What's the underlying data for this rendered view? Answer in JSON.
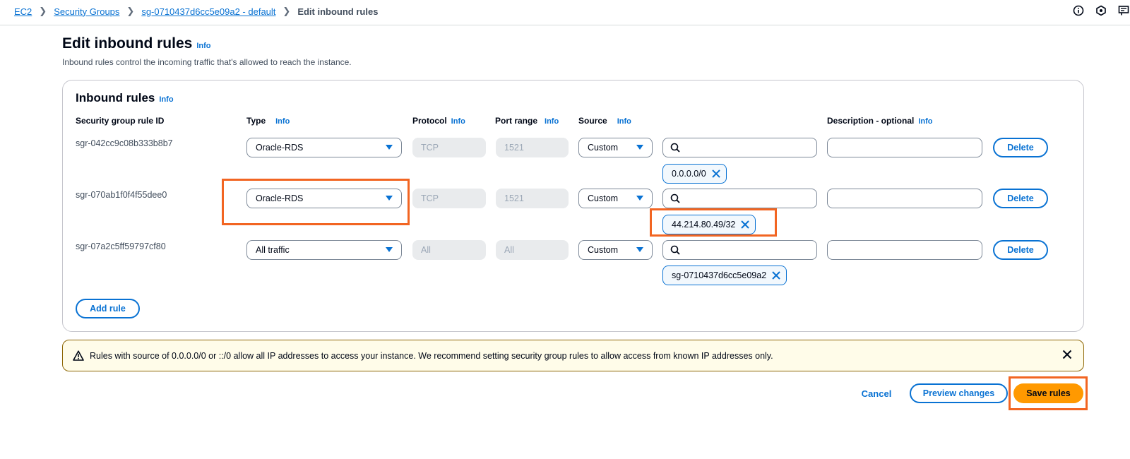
{
  "breadcrumb": {
    "items": [
      "EC2",
      "Security Groups",
      "sg-0710437d6cc5e09a2 - default"
    ],
    "current": "Edit inbound rules"
  },
  "header": {
    "title": "Edit inbound rules",
    "info": "Info",
    "description": "Inbound rules control the incoming traffic that's allowed to reach the instance."
  },
  "container": {
    "title": "Inbound rules",
    "info": "Info"
  },
  "columns": {
    "rule_id": "Security group rule ID",
    "type": "Type",
    "protocol": "Protocol",
    "port_range": "Port range",
    "source": "Source",
    "description": "Description - optional",
    "info": "Info"
  },
  "rules": [
    {
      "id": "sgr-042cc9c08b333b8b7",
      "type": "Oracle-RDS",
      "protocol": "TCP",
      "port": "1521",
      "source": "Custom",
      "token": "0.0.0.0/0",
      "delete": "Delete"
    },
    {
      "id": "sgr-070ab1f0f4f55dee0",
      "type": "Oracle-RDS",
      "protocol": "TCP",
      "port": "1521",
      "source": "Custom",
      "token": "44.214.80.49/32",
      "delete": "Delete"
    },
    {
      "id": "sgr-07a2c5ff59797cf80",
      "type": "All traffic",
      "protocol": "All",
      "port": "All",
      "source": "Custom",
      "token": "sg-0710437d6cc5e09a2",
      "delete": "Delete"
    }
  ],
  "add_rule": "Add rule",
  "warning": {
    "text": "Rules with source of 0.0.0.0/0 or ::/0 allow all IP addresses to access your instance. We recommend setting security group rules to allow access from known IP addresses only."
  },
  "footer": {
    "cancel": "Cancel",
    "preview": "Preview changes",
    "save": "Save rules"
  },
  "icons": {
    "top": [
      "info-circle-icon",
      "notifications-icon",
      "feedback-icon"
    ],
    "search": "search-icon",
    "token_close": "close-icon",
    "warning": "warning-icon"
  },
  "colors": {
    "link": "#0972d3",
    "primary": "#ff9900",
    "highlight": "#f26522",
    "warning_border": "#8d6605",
    "warning_bg": "#fffce9"
  }
}
